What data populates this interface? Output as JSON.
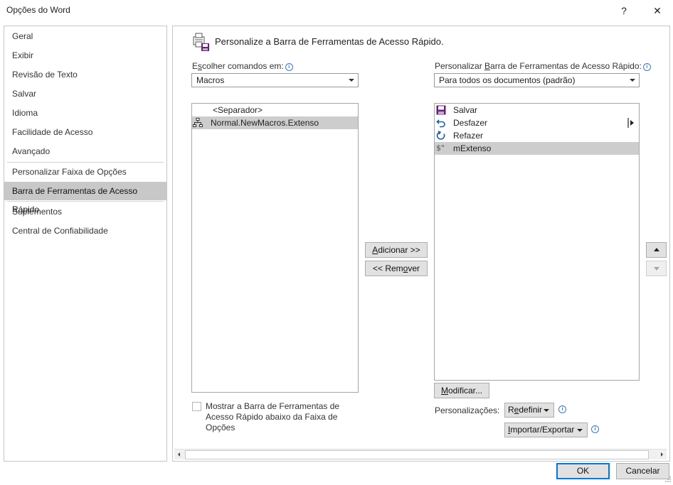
{
  "window": {
    "title": "Opções do Word",
    "help_glyph": "?",
    "close_glyph": "✕"
  },
  "nav": {
    "items": [
      {
        "label": "Geral"
      },
      {
        "label": "Exibir"
      },
      {
        "label": "Revisão de Texto"
      },
      {
        "label": "Salvar"
      },
      {
        "label": "Idioma"
      },
      {
        "label": "Facilidade de Acesso"
      },
      {
        "label": "Avançado"
      },
      {
        "label": "Personalizar Faixa de Opções"
      },
      {
        "label": "Barra de Ferramentas de Acesso Rápido",
        "selected": true
      },
      {
        "label": "Suplementos"
      },
      {
        "label": "Central de Confiabilidade"
      }
    ]
  },
  "main": {
    "heading": "Personalize a Barra de Ferramentas de Acesso Rápido.",
    "choose_label_pre": "E",
    "choose_label_u": "s",
    "choose_label_post": "colher comandos em:",
    "choose_value": "Macros",
    "customize_label_pre": "Personalizar ",
    "customize_label_u": "B",
    "customize_label_post": "arra de Ferramentas de Acesso Rápido:",
    "customize_value": "Para todos os documentos (padrão)",
    "left_list": [
      {
        "label": "<Separador>",
        "icon": ""
      },
      {
        "label": "Normal.NewMacros.Extenso",
        "icon": "macro-icon",
        "selected": true
      }
    ],
    "right_list": [
      {
        "label": "Salvar",
        "icon": "save-icon"
      },
      {
        "label": "Desfazer",
        "icon": "undo-icon"
      },
      {
        "label": "Refazer",
        "icon": "redo-icon"
      },
      {
        "label": "mExtenso",
        "icon": "macro-dollar-icon",
        "selected": true
      }
    ],
    "add_button_u": "A",
    "add_button_rest": "dicionar >>",
    "remove_button_pre": "<< Rem",
    "remove_button_u": "o",
    "remove_button_post": "ver",
    "modify_button_pre": "",
    "modify_button_u": "M",
    "modify_button_post": "odificar...",
    "checkbox_label": "Mostrar a Barra de Ferramentas de Acesso Rápido abaixo da Faixa de Opções",
    "checkbox_checked": false,
    "customizations_label": "Personalizações:",
    "reset_button_pre": "R",
    "reset_button_u": "e",
    "reset_button_post": "definir",
    "import_button_pre": "",
    "import_button_u": "I",
    "import_button_post": "mportar/Exportar"
  },
  "footer": {
    "ok_label": "OK",
    "cancel_label": "Cancelar"
  },
  "colors": {
    "selection_gray": "#cdcdcd",
    "accent_blue": "#0078d7",
    "save_purple": "#68217a",
    "undo_blue": "#1f5fa8"
  }
}
